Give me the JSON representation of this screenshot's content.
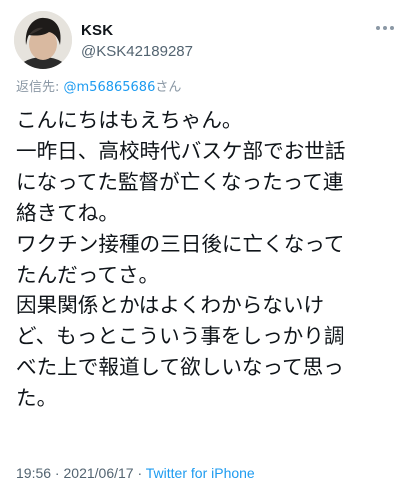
{
  "author": {
    "display_name": "KSK",
    "handle": "@KSK42189287",
    "avatar_icon": "avatar-photo"
  },
  "menu_icon": "more-horizontal-icon",
  "reply": {
    "prefix": "返信先: ",
    "mention": "@m56865686",
    "suffix": "さん"
  },
  "tweet_lines": [
    "こんにちはもえちゃん。",
    "一昨日、高校時代バスケ部でお世話",
    "になってた監督が亡くなったって連",
    "絡きてね。",
    "ワクチン接種の三日後に亡くなって",
    "たんだってさ。",
    "因果関係とかはよくわからないけ",
    "ど、もっとこういう事をしっかり調",
    "べた上で報道して欲しいなって思っ",
    "た。"
  ],
  "meta": {
    "time": "19:56",
    "sep1": " · ",
    "date": "2021/06/17",
    "sep2": " · ",
    "source": "Twitter for iPhone"
  },
  "colors": {
    "text": "#0f1419",
    "secondary": "#536471",
    "link": "#1d9bf0"
  }
}
